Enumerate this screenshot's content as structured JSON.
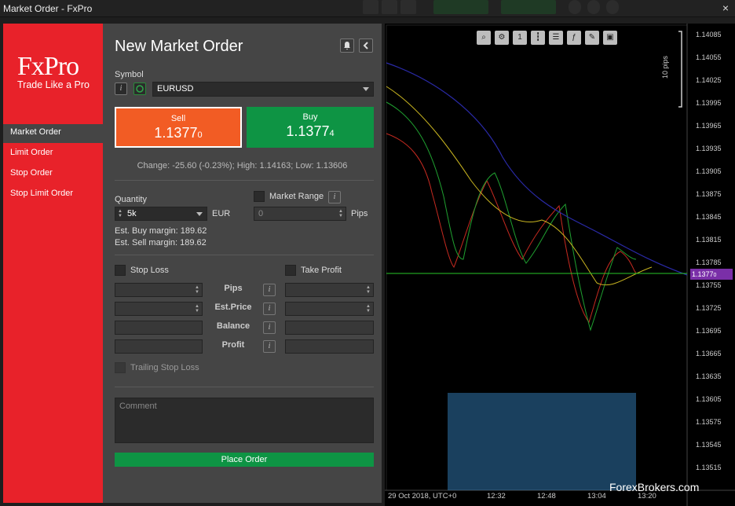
{
  "window": {
    "title": "Market Order - FxPro",
    "close_glyph": "×"
  },
  "sidebar": {
    "logo": "FxPro",
    "tagline": "Trade Like a Pro",
    "items": [
      {
        "label": "Market Order",
        "active": true
      },
      {
        "label": "Limit Order",
        "active": false
      },
      {
        "label": "Stop Order",
        "active": false
      },
      {
        "label": "Stop Limit Order",
        "active": false
      }
    ]
  },
  "form": {
    "title": "New Market Order",
    "symbol": {
      "label": "Symbol",
      "value": "EURUSD",
      "info_glyph": "i"
    },
    "sell": {
      "label": "Sell",
      "price_main": "1.1377",
      "price_small": "0"
    },
    "buy": {
      "label": "Buy",
      "price_main": "1.1377",
      "price_small": "4"
    },
    "change_text": "Change: -25.60 (-0.23%); High: 1.14163; Low: 1.13606",
    "quantity": {
      "label": "Quantity",
      "value": "5k",
      "unit": "EUR"
    },
    "market_range": {
      "label": "Market Range",
      "value": "0",
      "unit": "Pips"
    },
    "est_buy_margin": "Est. Buy margin: 189.62",
    "est_sell_margin": "Est. Sell margin: 189.62",
    "stop_loss": {
      "label": "Stop Loss"
    },
    "take_profit": {
      "label": "Take Profit"
    },
    "rows": [
      "Pips",
      "Est.Price",
      "Balance",
      "Profit"
    ],
    "trailing_stop": {
      "label": "Trailing Stop Loss"
    },
    "comment_placeholder": "Comment",
    "place_order_label": "Place Order"
  },
  "chart": {
    "price_ticks": [
      "1.14085",
      "1.14055",
      "1.14025",
      "1.13995",
      "1.13965",
      "1.13935",
      "1.13905",
      "1.13875",
      "1.13845",
      "1.13815",
      "1.13785",
      "1.13755",
      "1.13725",
      "1.13695",
      "1.13665",
      "1.13635",
      "1.13605",
      "1.13575",
      "1.13545",
      "1.13515"
    ],
    "current_price": "1.1377",
    "current_price_small": "0",
    "pips_label": "10 pips",
    "time_ticks": [
      "29 Oct 2018, UTC+0",
      "12:32",
      "12:48",
      "13:04",
      "13:20"
    ],
    "toolbar_icons": [
      "zoom-icon",
      "chart-settings-icon",
      "timeframe-icon",
      "candles-icon",
      "indicators-icon",
      "fxpro-icon",
      "drawing-icon",
      "screenshot-icon"
    ],
    "timeframe_label": "1",
    "colors": {
      "bull": "#28c828",
      "bear": "#e83a2a",
      "price_line": "#28c828",
      "volume": "#3a8fd0",
      "current_price_bg": "#7a2fa8"
    }
  },
  "watermark": "ForexBrokers.com"
}
